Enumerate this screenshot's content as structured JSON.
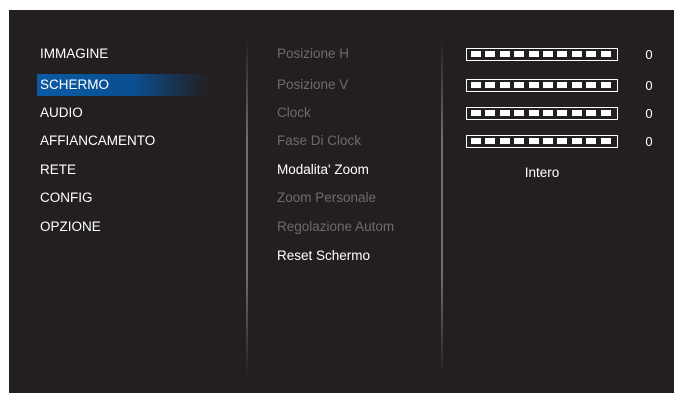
{
  "menu": {
    "items": [
      {
        "label": "IMMAGINE"
      },
      {
        "label": "SCHERMO"
      },
      {
        "label": "AUDIO"
      },
      {
        "label": "AFFIANCAMENTO"
      },
      {
        "label": "RETE"
      },
      {
        "label": "CONFIG"
      },
      {
        "label": "OPZIONE"
      }
    ],
    "selected": "SCHERMO",
    "selected_color": "#0b5aa6"
  },
  "submenu": {
    "items": [
      {
        "label": "Posizione H"
      },
      {
        "label": "Posizione V"
      },
      {
        "label": "Clock"
      },
      {
        "label": "Fase Di Clock"
      },
      {
        "label": "Modalita' Zoom"
      },
      {
        "label": "Zoom Personale"
      },
      {
        "label": "Regolazione Autom"
      },
      {
        "label": "Reset Schermo"
      }
    ],
    "enabled": [
      "Modalita' Zoom",
      "Reset Schermo"
    ],
    "disabled_color": "#6d6b6c"
  },
  "values": {
    "posizione_h": "0",
    "posizione_v": "0",
    "clock": "0",
    "fase_di_clock": "0",
    "modalita_zoom": "Intero"
  },
  "background_color": "#231f20"
}
